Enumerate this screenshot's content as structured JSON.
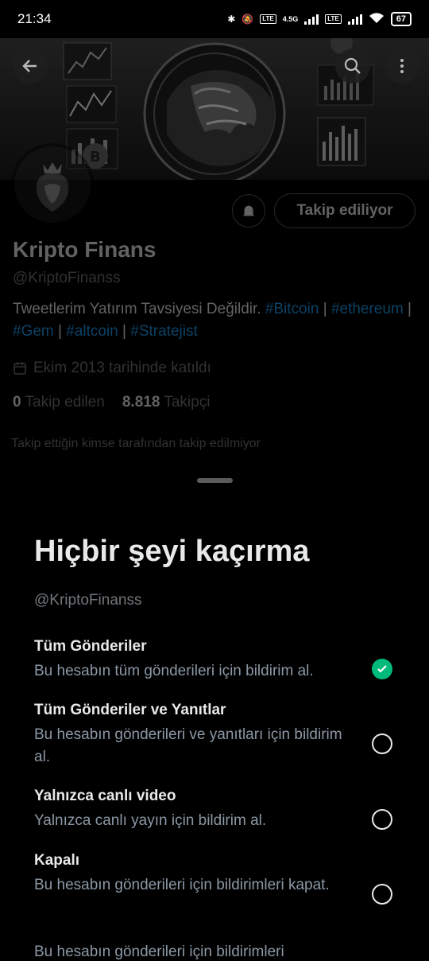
{
  "status_bar": {
    "time": "21:34",
    "network": "4.5G",
    "battery": "67"
  },
  "header": {
    "back_icon": "arrow-left-icon",
    "search_icon": "search-icon",
    "more_icon": "more-vertical-icon"
  },
  "profile": {
    "follow_label": "Takip ediliyor",
    "name": "Kripto Finans",
    "handle": "@KriptoFinanss",
    "bio_text": "Tweetlerim Yatırım Tavsiyesi Değildir.",
    "bio_tags": [
      "#Bitcoin",
      "#ethereum",
      "#Gem",
      "#altcoin",
      "#Stratejist"
    ],
    "joined": "Ekim 2013 tarihinde katıldı",
    "following_count": "0",
    "following_label": "Takip edilen",
    "followers_count": "8.818",
    "followers_label": "Takipçi",
    "not_followed": "Takip ettiğin kimse tarafından takip edilmiyor"
  },
  "sheet": {
    "title": "Hiçbir şeyi kaçırma",
    "subtitle": "@KriptoFinanss",
    "options": [
      {
        "title": "Tüm Gönderiler",
        "desc": "Bu hesabın tüm gönderileri için bildirim al.",
        "selected": true
      },
      {
        "title": "Tüm Gönderiler ve Yanıtlar",
        "desc": "Bu hesabın gönderileri ve yanıtları için bildirim al.",
        "selected": false
      },
      {
        "title": "Yalnızca canlı video",
        "desc": "Yalnızca canlı yayın için bildirim al.",
        "selected": false
      },
      {
        "title": "Kapalı",
        "desc": "Bu hesabın gönderileri için bildirimleri kapat.",
        "selected": false
      }
    ],
    "cutoff_text": "Bu hesabın gönderileri için bildirimleri"
  },
  "colors": {
    "accent": "#1d9bf0",
    "selected": "#00ba7c",
    "background": "#000000"
  }
}
